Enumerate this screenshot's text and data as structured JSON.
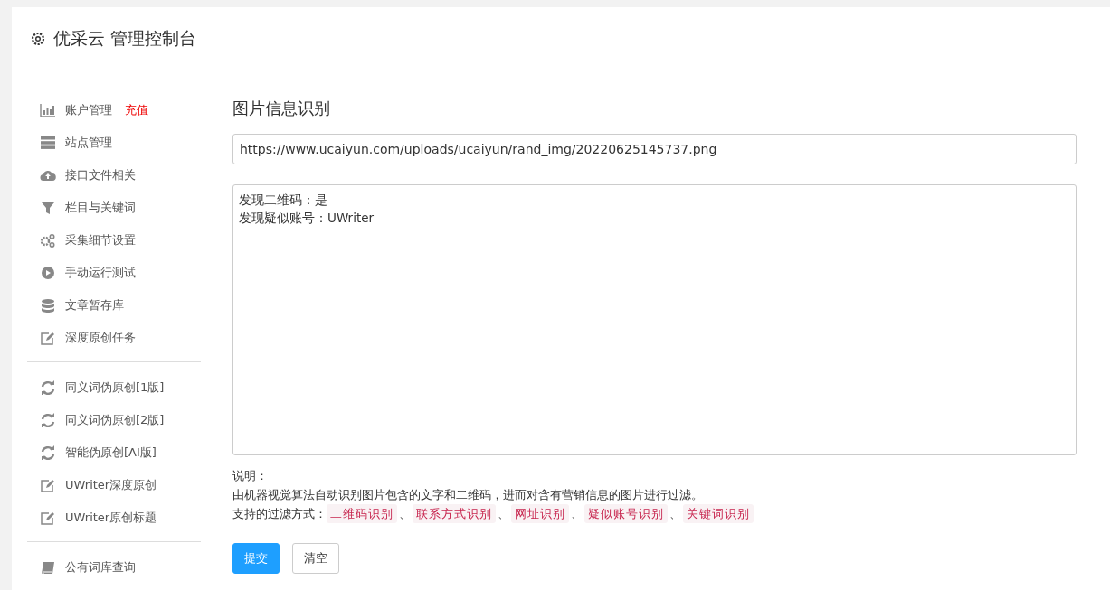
{
  "header": {
    "title": "优采云 管理控制台"
  },
  "sidebar": {
    "groups": [
      {
        "items": [
          {
            "kind": "chart",
            "label": "账户管理",
            "badge": "充值"
          },
          {
            "kind": "server",
            "label": "站点管理"
          },
          {
            "kind": "cloud",
            "label": "接口文件相关"
          },
          {
            "kind": "filter",
            "label": "栏目与关键词"
          },
          {
            "kind": "gears",
            "label": "采集细节设置"
          },
          {
            "kind": "play",
            "label": "手动运行测试"
          },
          {
            "kind": "database",
            "label": "文章暂存库"
          },
          {
            "kind": "edit",
            "label": "深度原创任务"
          }
        ]
      },
      {
        "items": [
          {
            "kind": "refresh",
            "label": "同义词伪原创[1版]"
          },
          {
            "kind": "refresh",
            "label": "同义词伪原创[2版]"
          },
          {
            "kind": "refresh",
            "label": "智能伪原创[AI版]"
          },
          {
            "kind": "edit",
            "label": "UWriter深度原创"
          },
          {
            "kind": "edit",
            "label": "UWriter原创标题"
          }
        ]
      },
      {
        "items": [
          {
            "kind": "book",
            "label": "公有词库查询"
          }
        ]
      }
    ]
  },
  "main": {
    "title": "图片信息识别",
    "url_field": {
      "value": "https://www.ucaiyun.com/uploads/ucaiyun/rand_img/20220625145737.png"
    },
    "result_box": {
      "lines": [
        "发现二维码：是",
        "发现疑似账号：UWriter"
      ]
    },
    "note_label": "说明：",
    "note_text": "由机器视觉算法自动识别图片包含的文字和二维码，进而对含有营销信息的图片进行过滤。",
    "filters_label": "支持的过滤方式：",
    "filters": [
      "二维码识别",
      "联系方式识别",
      "网址识别",
      "疑似账号识别",
      "关键词识别"
    ],
    "separator": "、",
    "buttons": [
      {
        "label": "提交",
        "kind": "primary"
      },
      {
        "label": "清空",
        "kind": "default"
      }
    ]
  }
}
